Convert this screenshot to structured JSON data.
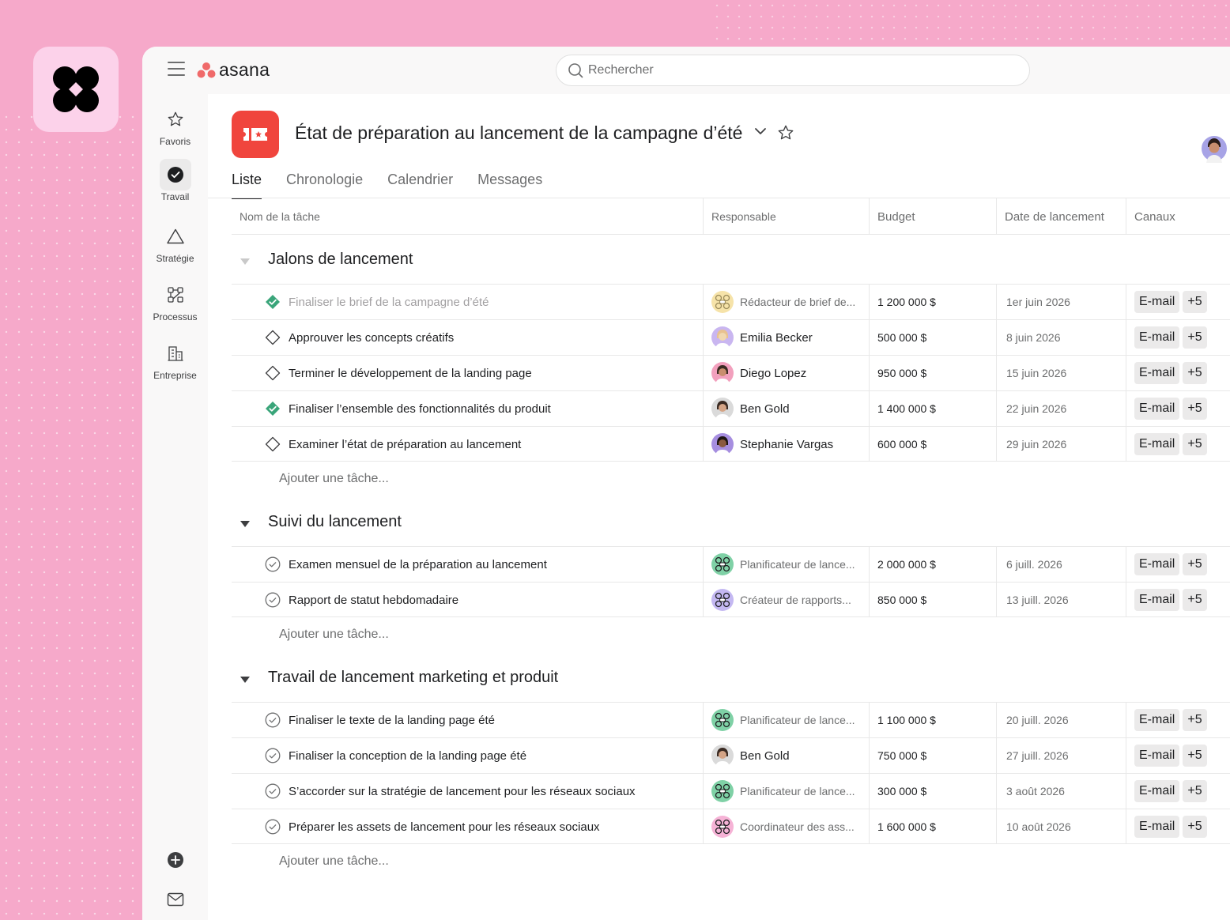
{
  "app": {
    "logo_text": "asana",
    "search_placeholder": "Rechercher"
  },
  "sidebar": {
    "items": [
      {
        "label": "Favoris",
        "icon": "star-icon"
      },
      {
        "label": "Travail",
        "icon": "check-circle-icon"
      },
      {
        "label": "Stratégie",
        "icon": "triangle-icon"
      },
      {
        "label": "Processus",
        "icon": "workflow-icon"
      },
      {
        "label": "Entreprise",
        "icon": "building-icon"
      }
    ],
    "bottom_icons": [
      "plus-circle-icon",
      "mail-icon",
      "user-avatar"
    ]
  },
  "project": {
    "title": "État de préparation au lancement de la campagne d’été",
    "icon_color": "#f0453d"
  },
  "tabs": [
    "Liste",
    "Chronologie",
    "Calendrier",
    "Messages"
  ],
  "columns": [
    "Nom de la tâche",
    "Responsable",
    "Budget",
    "Date de lancement",
    "Canaux"
  ],
  "add_task_label": "Ajouter une tâche...",
  "sections": [
    {
      "title": "Jalons de lancement",
      "tasks": [
        {
          "name": "Finaliser le brief de la campagne d’été",
          "status": "done-faded",
          "owner": "Rédacteur de brief de...",
          "owner_type": "bot-yellow",
          "budget": "1 200 000 $",
          "date": "1er juin 2026",
          "channel": "E-mail",
          "more": "+5"
        },
        {
          "name": "Approuver les concepts créatifs",
          "status": "milestone",
          "owner": "Emilia Becker",
          "owner_type": "person-purple",
          "budget": "500 000 $",
          "date": "8 juin 2026",
          "channel": "E-mail",
          "more": "+5"
        },
        {
          "name": "Terminer le développement de la landing page",
          "status": "milestone",
          "owner": "Diego Lopez",
          "owner_type": "person-pink",
          "budget": "950 000 $",
          "date": "15 juin 2026",
          "channel": "E-mail",
          "more": "+5"
        },
        {
          "name": "Finaliser l’ensemble des fonctionnalités du produit",
          "status": "done",
          "owner": "Ben Gold",
          "owner_type": "person-gray",
          "budget": "1 400 000 $",
          "date": "22 juin 2026",
          "channel": "E-mail",
          "more": "+5"
        },
        {
          "name": "Examiner l’état de préparation au lancement",
          "status": "milestone",
          "owner": "Stephanie Vargas",
          "owner_type": "person-violet",
          "budget": "600 000 $",
          "date": "29 juin 2026",
          "channel": "E-mail",
          "more": "+5"
        }
      ]
    },
    {
      "title": "Suivi du lancement",
      "tasks": [
        {
          "name": "Examen mensuel de la préparation au lancement",
          "status": "task",
          "owner": "Planificateur de lance...",
          "owner_type": "bot-green",
          "budget": "2 000 000 $",
          "date": "6 juill. 2026",
          "channel": "E-mail",
          "more": "+5"
        },
        {
          "name": "Rapport de statut hebdomadaire",
          "status": "task",
          "owner": "Créateur de rapports...",
          "owner_type": "bot-lilac",
          "budget": "850 000 $",
          "date": "13 juill. 2026",
          "channel": "E-mail",
          "more": "+5"
        }
      ]
    },
    {
      "title": "Travail de lancement marketing et produit",
      "tasks": [
        {
          "name": "Finaliser le texte de la landing page été",
          "status": "task",
          "owner": "Planificateur de lance...",
          "owner_type": "bot-green",
          "budget": "1 100 000 $",
          "date": "20 juill. 2026",
          "channel": "E-mail",
          "more": "+5"
        },
        {
          "name": "Finaliser la conception de la landing page été",
          "status": "task",
          "owner": "Ben Gold",
          "owner_type": "person-gray",
          "budget": "750 000 $",
          "date": "27 juill. 2026",
          "channel": "E-mail",
          "more": "+5"
        },
        {
          "name": "S’accorder sur la stratégie de lancement pour les réseaux sociaux",
          "status": "task",
          "owner": "Planificateur de lance...",
          "owner_type": "bot-green",
          "budget": "300 000 $",
          "date": "3 août 2026",
          "channel": "E-mail",
          "more": "+5"
        },
        {
          "name": "Préparer les assets de lancement pour les réseaux sociaux",
          "status": "task",
          "owner": "Coordinateur des ass...",
          "owner_type": "bot-pink",
          "budget": "1 600 000 $",
          "date": "10 août 2026",
          "channel": "E-mail",
          "more": "+5"
        }
      ]
    }
  ],
  "colors": {
    "background": "#f6a9ca",
    "brand_tile": "#fcd2ea",
    "project_icon": "#f0453d",
    "done_green": "#3aa57a",
    "asana_coral": "#f06a6a"
  }
}
